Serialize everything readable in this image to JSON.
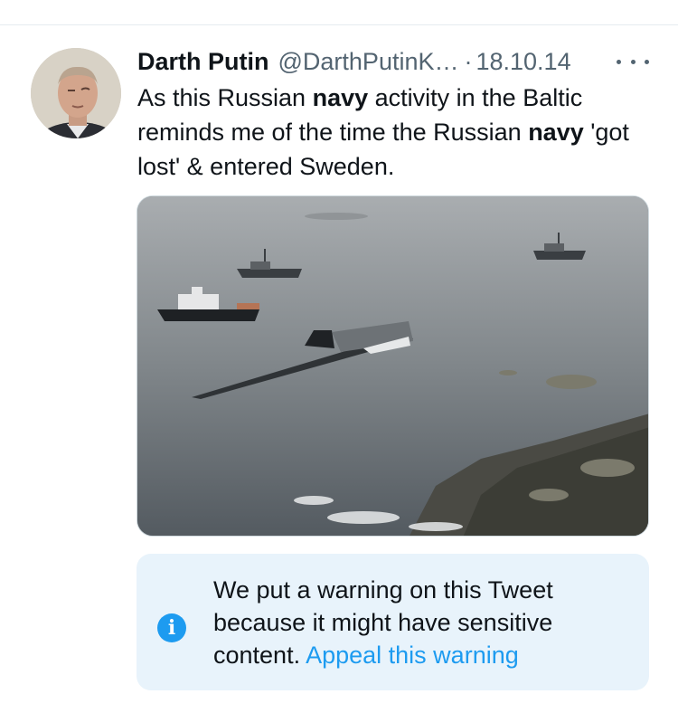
{
  "tweet": {
    "author_name": "Darth Putin",
    "author_handle": "@DarthPutinK…",
    "separator": "·",
    "date": "18.10.14",
    "text_parts": {
      "p1": "As this Russian ",
      "b1": "navy",
      "p2": " activity in the Baltic reminds me of the time the Russian ",
      "b2": "navy",
      "p3": " 'got lost' & entered Sweden."
    }
  },
  "icons": {
    "more": "more-horizontal-icon",
    "info": "info-icon",
    "info_glyph": "i"
  },
  "warning": {
    "message": "We put a warning on this Tweet because it might have sensitive content. ",
    "appeal_link": "Appeal this warning"
  },
  "colors": {
    "accent": "#1d9bf0",
    "secondary_text": "#536471",
    "warning_bg": "#e8f3fb"
  }
}
